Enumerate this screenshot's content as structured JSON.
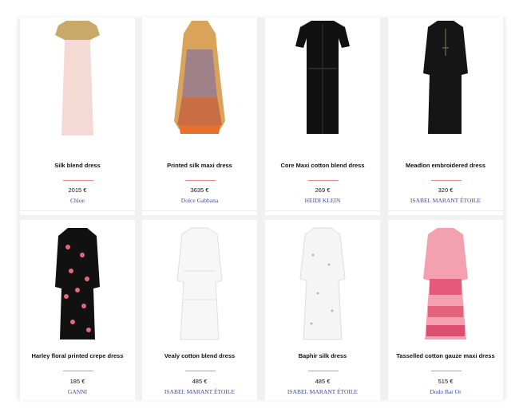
{
  "colors": {
    "accent": "#e88a86",
    "brand_link": "#3a45c8",
    "text": "#111111"
  },
  "products": [
    {
      "title": "Silk blend dress",
      "price": "2015 €",
      "brand": "Chloe"
    },
    {
      "title": "Printed silk maxi dress",
      "price": "3635 €",
      "brand": "Dolce Gabbana"
    },
    {
      "title": "Core Maxi cotton blend dress",
      "price": "269 €",
      "brand": "HEIDI KLEIN"
    },
    {
      "title": "Meadlon embroidered dress",
      "price": "320 €",
      "brand": "ISABEL MARANT ÉTOILE"
    },
    {
      "title": "Harley floral printed crepe dress",
      "price": "185 €",
      "brand": "GANNI"
    },
    {
      "title": "Vealy cotton blend dress",
      "price": "485 €",
      "brand": "ISABEL MARANT ÉTOILE"
    },
    {
      "title": "Baphir silk dress",
      "price": "485 €",
      "brand": "ISABEL MARANT ÉTOILE"
    },
    {
      "title": "Tasselled cotton gauze maxi dress",
      "price": "515 €",
      "brand": "Dodo Bar Or"
    }
  ],
  "actions": {
    "like_icon": "heart-icon",
    "share_icon": "share-icon"
  }
}
